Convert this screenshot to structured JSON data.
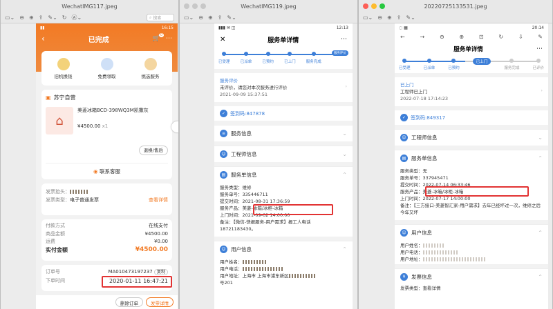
{
  "w1": {
    "title": "WechatIMG117.jpeg",
    "status_time": "16:15",
    "header": "已完成",
    "icons": [
      {
        "label": "旧机换钱"
      },
      {
        "label": "免费领取"
      },
      {
        "label": "挑选服务"
      }
    ],
    "store": "苏宁自营",
    "product_name": "美菱冰箱BCD-398WQ3M凯撒灰",
    "price": "¥4500.00",
    "qty": "x1",
    "refund_btn": "退换/售后",
    "contact": "联系客服",
    "invoice_title_label": "发票抬头：",
    "invoice_type_label": "发票类型：",
    "invoice_type": "电子普通发票",
    "invoice_detail": "查看详情",
    "pay_rows": [
      {
        "k": "付款方式",
        "v": "在线支付"
      },
      {
        "k": "商品金额",
        "v": "¥4500.00"
      },
      {
        "k": "运费",
        "v": "¥0.00"
      }
    ],
    "paid_label": "实付金额",
    "paid": "¥4500.00",
    "order_label": "订单号",
    "order_no": "MA010473197237",
    "copy": "复制",
    "time_label": "下单时间",
    "time": "2020-01-11 16:47:21",
    "del_btn": "删除订单",
    "invoice_btn": "发票详情",
    "cart_badge": "0",
    "search": "搜索"
  },
  "w2": {
    "title": "WechatIMG119.jpeg",
    "status_time": "12:13",
    "header": "服务单详情",
    "steps": [
      "已受理",
      "已派单",
      "已预约",
      "已上门",
      "服务完成"
    ],
    "active_step": "服务评价",
    "eval_title": "服务评价",
    "eval_text": "未评价，请您对本次服务进行评价",
    "eval_time": "2021-09-09 15:37:51",
    "code": "签到码:847878",
    "sec_service": "服务信息",
    "sec_engineer": "工程师信息",
    "sec_order": "服务单信息",
    "order_rows": [
      {
        "k": "服务类型：",
        "v": "维修"
      },
      {
        "k": "服务单号：",
        "v": "335446711"
      },
      {
        "k": "提交时间：",
        "v": "2021-08-31 17:36:59"
      },
      {
        "k": "服务产品：",
        "v": "美菱-冰箱/冰柜-冰箱"
      },
      {
        "k": "上门时间：",
        "v": "2021-09-02 14:00:00"
      },
      {
        "k": "备注：",
        "v": "【微信-快报服务-用户需求】报工人电话"
      }
    ],
    "phone_note": "18721183430。",
    "sec_user": "用户信息",
    "user_rows": [
      {
        "k": "用户姓名："
      },
      {
        "k": "用户电话："
      },
      {
        "k": "用户地址：",
        "v": "上海市 上海市浦东新区"
      }
    ],
    "addr_tail": "号201"
  },
  "w3": {
    "title": "20220725133531.jpeg",
    "status_time": "20:14",
    "header": "服务单详情",
    "steps": [
      "已受理",
      "已派单",
      "已预约",
      "服务完成",
      "已评价"
    ],
    "active_step": "已上门",
    "status_title": "已上门",
    "status_text": "工程师已上门",
    "status_time2": "2022-07-18 17:14:23",
    "code": "签到码:849317",
    "sec_engineer": "工程师信息",
    "sec_order": "服务单信息",
    "order_rows": [
      {
        "k": "服务类型：",
        "v": "无"
      },
      {
        "k": "服务单号：",
        "v": "337945471"
      },
      {
        "k": "提交时间：",
        "v": "2022-07-14 06:33:46"
      },
      {
        "k": "服务产品：",
        "v": "美菱-冰箱/冰柜-冰箱"
      },
      {
        "k": "上门时间：",
        "v": "2022-07-17 14:00:00"
      },
      {
        "k": "备注：",
        "v": "【三方接口-美菱智汇家-用户需求】去年已经坏过一次，维修之后今年又坏"
      }
    ],
    "sec_user": "用户信息",
    "user_rows": [
      {
        "k": "用户姓名："
      },
      {
        "k": "用户电话："
      },
      {
        "k": "用户地址："
      }
    ],
    "sec_invoice": "发票信息",
    "invoice_row": "发票类型：查看详情"
  }
}
